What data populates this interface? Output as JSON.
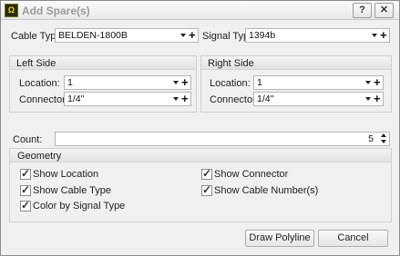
{
  "window": {
    "title": "Add Spare(s)",
    "app_icon_text": "Ω",
    "help_label": "?",
    "close_label": "✕"
  },
  "cable_type": {
    "label": "Cable Type:",
    "value": "BELDEN-1800B"
  },
  "signal_type": {
    "label": "Signal Type:",
    "value": "1394b"
  },
  "left_side": {
    "title": "Left Side",
    "location_label": "Location:",
    "location_value": "1",
    "connector_label": "Connector:",
    "connector_value": "1/4\""
  },
  "right_side": {
    "title": "Right Side",
    "location_label": "Location:",
    "location_value": "1",
    "connector_label": "Connector:",
    "connector_value": "1/4\""
  },
  "count": {
    "label": "Count:",
    "value": "5"
  },
  "geometry": {
    "title": "Geometry",
    "options": [
      {
        "label": "Show Location",
        "checked": true
      },
      {
        "label": "Show Connector",
        "checked": true
      },
      {
        "label": "Show Cable Type",
        "checked": true
      },
      {
        "label": "Show Cable Number(s)",
        "checked": true
      },
      {
        "label": "Color by Signal Type",
        "checked": true
      }
    ]
  },
  "buttons": {
    "draw_polyline": "Draw Polyline",
    "cancel": "Cancel"
  },
  "glyphs": {
    "check": "✓",
    "plus": "+"
  }
}
